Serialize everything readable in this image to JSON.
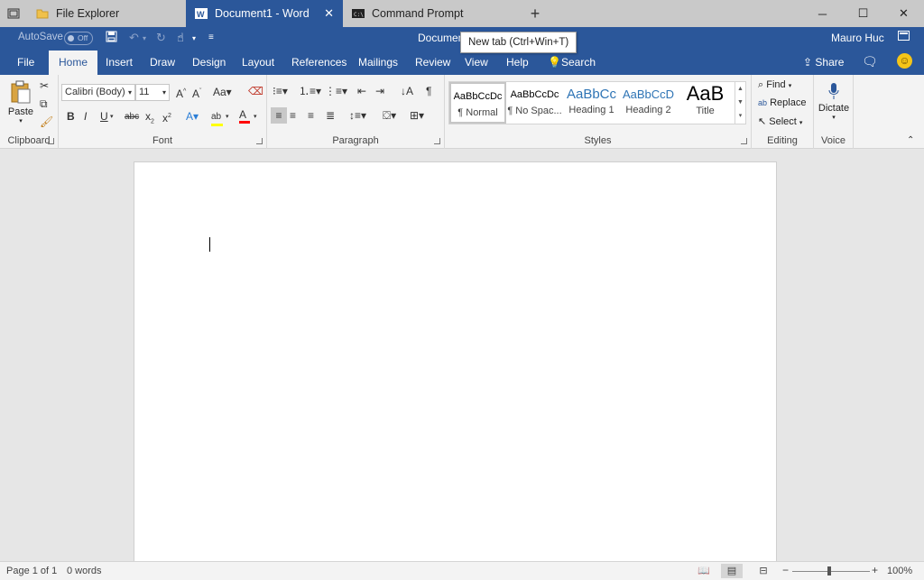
{
  "tabs": {
    "explorer": "File Explorer",
    "word": "Document1 - Word",
    "cmd": "Command Prompt",
    "tooltip": "New tab (Ctrl+Win+T)"
  },
  "qat": {
    "autosave": "AutoSave",
    "autosave_state": "Off",
    "doc_title": "Document",
    "user": "Mauro Huc"
  },
  "menu": {
    "file": "File",
    "home": "Home",
    "insert": "Insert",
    "draw": "Draw",
    "design": "Design",
    "layout": "Layout",
    "references": "References",
    "mailings": "Mailings",
    "review": "Review",
    "view": "View",
    "help": "Help",
    "search": "Search",
    "share": "Share"
  },
  "ribbon": {
    "clipboard": {
      "label": "Clipboard",
      "paste": "Paste"
    },
    "font": {
      "label": "Font",
      "name": "Calibri (Body)",
      "size": "11"
    },
    "paragraph": {
      "label": "Paragraph"
    },
    "styles": {
      "label": "Styles",
      "items": [
        {
          "preview": "AaBbCcDc",
          "name": "¶ Normal"
        },
        {
          "preview": "AaBbCcDc",
          "name": "¶ No Spac..."
        },
        {
          "preview": "AaBbCc",
          "name": "Heading 1"
        },
        {
          "preview": "AaBbCcD",
          "name": "Heading 2"
        },
        {
          "preview": "AaB",
          "name": "Title"
        }
      ]
    },
    "editing": {
      "label": "Editing",
      "find": "Find",
      "replace": "Replace",
      "select": "Select"
    },
    "voice": {
      "label": "Voice",
      "dictate": "Dictate"
    }
  },
  "status": {
    "page": "Page 1 of 1",
    "words": "0 words",
    "zoom": "100%",
    "zoom_level": 1.0
  },
  "colors": {
    "word_blue": "#2b579a",
    "highlight": "#ffff00",
    "font_color": "#ff0000"
  }
}
